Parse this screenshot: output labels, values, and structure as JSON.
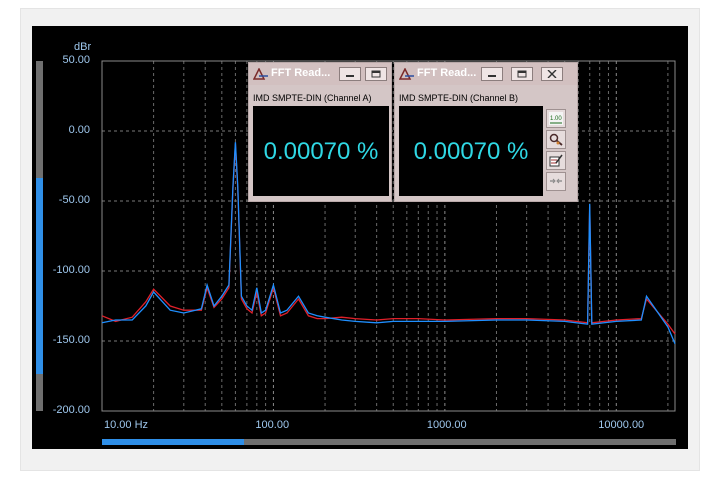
{
  "y_unit": "dBr",
  "y_ticks": [
    "50.00",
    "0.00",
    "-50.00",
    "-100.00",
    "-150.00",
    "-200.00"
  ],
  "x_ticks": [
    "10.00 Hz",
    "100.00",
    "1000.00",
    "10000.00"
  ],
  "chart_data": {
    "type": "line",
    "title": "",
    "xlabel": "",
    "ylabel": "dBr",
    "x_scale": "log",
    "xlim": [
      10,
      22000
    ],
    "ylim": [
      -200,
      50
    ],
    "grid": true,
    "series": [
      {
        "color": "#1f8fff",
        "x": [
          10,
          12,
          15,
          18,
          20,
          25,
          30,
          38,
          41,
          45,
          50,
          55,
          58,
          60,
          62,
          65,
          70,
          75,
          80,
          85,
          90,
          100,
          110,
          120,
          140,
          160,
          180,
          200,
          250,
          300,
          400,
          500,
          700,
          1000,
          2000,
          3000,
          5000,
          6800,
          7000,
          7200,
          10000,
          14000,
          15000,
          20000,
          22000
        ],
        "y": [
          -137,
          -135,
          -135,
          -125,
          -115,
          -128,
          -130,
          -127,
          -110,
          -125,
          -118,
          -110,
          -40,
          -8,
          -40,
          -118,
          -125,
          -128,
          -112,
          -130,
          -128,
          -110,
          -130,
          -128,
          -118,
          -130,
          -132,
          -133,
          -135,
          -136,
          -137,
          -136,
          -136,
          -136,
          -135,
          -135,
          -136,
          -138,
          -52,
          -138,
          -136,
          -135,
          -118,
          -140,
          -152
        ]
      },
      {
        "color": "#e0202a",
        "x": [
          10,
          12,
          15,
          18,
          20,
          25,
          30,
          38,
          41,
          45,
          50,
          55,
          58,
          60,
          62,
          65,
          70,
          75,
          80,
          85,
          90,
          100,
          110,
          120,
          140,
          160,
          180,
          200,
          250,
          300,
          400,
          500,
          700,
          1000,
          2000,
          3000,
          5000,
          6800,
          7000,
          7200,
          10000,
          14000,
          15000,
          20000,
          22000
        ],
        "y": [
          -132,
          -136,
          -133,
          -122,
          -113,
          -125,
          -128,
          -128,
          -112,
          -126,
          -120,
          -112,
          -42,
          -9,
          -42,
          -120,
          -127,
          -130,
          -115,
          -132,
          -130,
          -112,
          -132,
          -130,
          -120,
          -132,
          -134,
          -134,
          -133,
          -134,
          -135,
          -134,
          -134,
          -135,
          -134,
          -134,
          -135,
          -137,
          -54,
          -137,
          -135,
          -134,
          -120,
          -138,
          -145
        ]
      }
    ]
  },
  "fft_windows": [
    {
      "title": "FFT Read...",
      "subtitle": "IMD SMPTE-DIN (Channel A)",
      "value": "0.00070 %"
    },
    {
      "title": "FFT Read...",
      "subtitle": "IMD SMPTE-DIN (Channel B)",
      "value": "0.00070 %"
    }
  ],
  "side_buttons": [
    {
      "icon": "stats-icon",
      "label": "1.00"
    },
    {
      "icon": "settings-icon"
    },
    {
      "icon": "edit-icon"
    },
    {
      "icon": "link-icon"
    }
  ],
  "colors": {
    "accent": "#2f8fe8",
    "readout": "#2fd8e4",
    "axis_text": "#9fc8ee"
  }
}
